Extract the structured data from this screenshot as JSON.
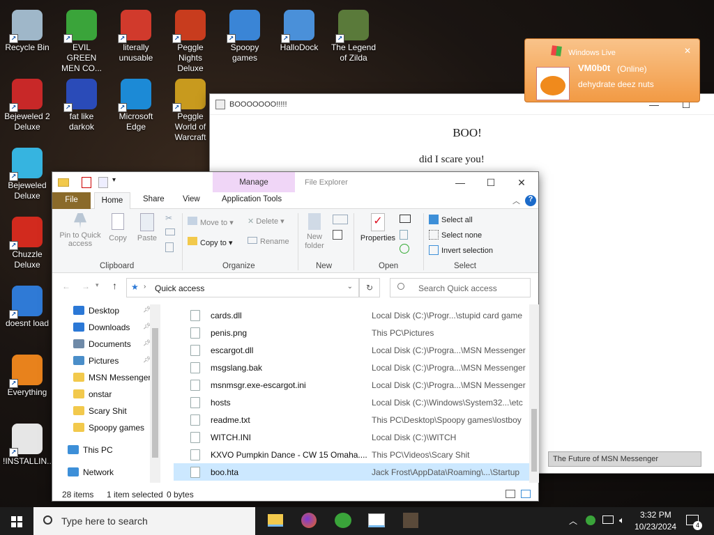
{
  "desktop_icons": [
    {
      "label": "Recycle Bin",
      "icon": "recycle-bin-icon",
      "color": "#9fb7c9"
    },
    {
      "label": "EVIL GREEN MEN CO...",
      "icon": "msn-buddies-icon",
      "color": "#3aa43a"
    },
    {
      "label": "literally unusable",
      "icon": "chrome-icon",
      "color": "#d13a2c"
    },
    {
      "label": "Peggle Nights Deluxe",
      "icon": "peggle-icon",
      "color": "#c83c1e"
    },
    {
      "label": "Spoopy games",
      "icon": "spoopy-folder-icon",
      "color": "#3a85d6"
    },
    {
      "label": "HalloDock",
      "icon": "hallodock-icon",
      "color": "#4a90d9"
    },
    {
      "label": "The Legend of Zilda",
      "icon": "zilda-icon",
      "color": "#5a7a3a"
    },
    {
      "label": "Bejeweled 2 Deluxe",
      "icon": "bejeweled2-icon",
      "color": "#c82828"
    },
    {
      "label": "fat like darkok",
      "icon": "mpl-icon",
      "color": "#2a4bb8"
    },
    {
      "label": "Microsoft Edge",
      "icon": "edge-icon",
      "color": "#1c8ad6"
    },
    {
      "label": "Peggle World of Warcraft",
      "icon": "peggle-wow-icon",
      "color": "#c89a1e"
    },
    {
      "label": "Bejeweled Deluxe",
      "icon": "bejeweled-icon",
      "color": "#36b4e0"
    },
    {
      "label": "Chuzzle Deluxe",
      "icon": "chuzzle-icon",
      "color": "#d22a1e"
    },
    {
      "label": "doesnt load",
      "icon": "thunderbird-icon",
      "color": "#2f7ad6"
    },
    {
      "label": "Everything",
      "icon": "everything-search-icon",
      "color": "#e8821c"
    },
    {
      "label": "!INSTALLIN...",
      "icon": "text-file-icon",
      "color": "#e6e6e6"
    }
  ],
  "boo_window": {
    "title": "BOOOOOOO!!!!!",
    "heading": "BOO!",
    "body": "did I scare you!"
  },
  "msn_popup": {
    "title": "Windows Live",
    "user": "VM0b0t",
    "status": "(Online)",
    "message": "dehydrate deez nuts",
    "footer": "The Future of MSN Messenger"
  },
  "file_explorer": {
    "title": "File Explorer",
    "manage_label": "Manage",
    "tabs": [
      "File",
      "Home",
      "Share",
      "View",
      "Application Tools"
    ],
    "ribbon": {
      "pin": "Pin to Quick access",
      "copy": "Copy",
      "paste": "Paste",
      "move_to": "Move to",
      "delete": "Delete",
      "copy_to": "Copy to",
      "rename": "Rename",
      "new_folder": "New folder",
      "properties": "Properties",
      "select_all": "Select all",
      "select_none": "Select none",
      "invert": "Invert selection",
      "groups": [
        "Clipboard",
        "Organize",
        "New",
        "Open",
        "Select"
      ]
    },
    "address": "Quick access",
    "search_placeholder": "Search Quick access",
    "nav": [
      {
        "label": "Desktop",
        "color": "#2b78d6",
        "pinned": true
      },
      {
        "label": "Downloads",
        "color": "#2b78d6",
        "pinned": true
      },
      {
        "label": "Documents",
        "color": "#6f8aa8",
        "pinned": true
      },
      {
        "label": "Pictures",
        "color": "#4a8ec9",
        "pinned": true
      },
      {
        "label": "MSN Messenger",
        "color": "#f2c94c",
        "pinned": false
      },
      {
        "label": "onstar",
        "color": "#f2c94c",
        "pinned": false
      },
      {
        "label": "Scary Shit",
        "color": "#f2c94c",
        "pinned": false
      },
      {
        "label": "Spoopy games",
        "color": "#f2c94c",
        "pinned": false
      },
      {
        "label": "This PC",
        "color": "#3d8fd8",
        "pinned": false
      },
      {
        "label": "Network",
        "color": "#3d8fd8",
        "pinned": false
      }
    ],
    "files": [
      {
        "name": "cards.dll",
        "location": "Local Disk (C:)\\Progr...\\stupid card game"
      },
      {
        "name": "penis.png",
        "location": "This PC\\Pictures"
      },
      {
        "name": "escargot.dll",
        "location": "Local Disk (C:)\\Progra...\\MSN Messenger"
      },
      {
        "name": "msgslang.bak",
        "location": "Local Disk (C:)\\Progra...\\MSN Messenger"
      },
      {
        "name": "msnmsgr.exe-escargot.ini",
        "location": "Local Disk (C:)\\Progra...\\MSN Messenger"
      },
      {
        "name": "hosts",
        "location": "Local Disk (C:)\\Windows\\System32...\\etc"
      },
      {
        "name": "readme.txt",
        "location": "This PC\\Desktop\\Spoopy games\\lostboy"
      },
      {
        "name": "WITCH.INI",
        "location": "Local Disk (C:)\\WITCH"
      },
      {
        "name": "KXVO Pumpkin Dance - CW 15 Omaha....",
        "location": "This PC\\Videos\\Scary Shit"
      },
      {
        "name": "boo.hta",
        "location": "Jack Frost\\AppData\\Roaming\\...\\Startup"
      }
    ],
    "status": {
      "items": "28 items",
      "selected": "1 item selected",
      "size": "0 bytes"
    }
  },
  "taskbar": {
    "search_placeholder": "Type here to search",
    "time": "3:32 PM",
    "date": "10/23/2024",
    "notifications": "4"
  }
}
